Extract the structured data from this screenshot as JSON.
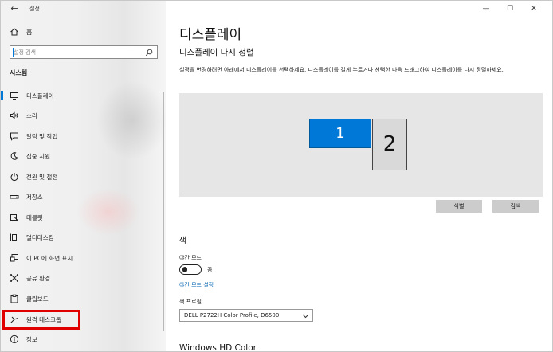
{
  "window": {
    "title": "설정",
    "controls": {
      "minimize": "—",
      "maximize": "☐",
      "close": "✕"
    }
  },
  "sidebar": {
    "home_label": "홈",
    "search": {
      "placeholder": "설정 검색",
      "value": ""
    },
    "section_title": "시스템",
    "items": [
      {
        "label": "디스플레이",
        "icon": "monitor-icon",
        "selected": true
      },
      {
        "label": "소리",
        "icon": "speaker-icon"
      },
      {
        "label": "알림 및 작업",
        "icon": "notification-icon"
      },
      {
        "label": "집중 지원",
        "icon": "moon-icon"
      },
      {
        "label": "전원 및 절전",
        "icon": "power-icon"
      },
      {
        "label": "저장소",
        "icon": "storage-icon"
      },
      {
        "label": "태블릿",
        "icon": "tablet-icon"
      },
      {
        "label": "멀티태스킹",
        "icon": "multitasking-icon"
      },
      {
        "label": "이 PC에 화면 표시",
        "icon": "project-icon"
      },
      {
        "label": "공유 환경",
        "icon": "shared-experience-icon"
      },
      {
        "label": "클립보드",
        "icon": "clipboard-icon"
      },
      {
        "label": "원격 데스크톱",
        "icon": "remote-desktop-icon",
        "highlighted": true
      },
      {
        "label": "정보",
        "icon": "info-icon"
      }
    ]
  },
  "main": {
    "page_title": "디스플레이",
    "arrange_title": "디스플레이 다시 정렬",
    "arrange_description": "설정을 변경하려면 아래에서 디스플레이를 선택하세요. 디스플레이를 길게 누르거나 선택한 다음 드래그하여 디스플레이를 다시 정렬하세요.",
    "monitors": [
      {
        "number": "1",
        "selected": true
      },
      {
        "number": "2",
        "selected": false
      }
    ],
    "identify_button": "식별",
    "detect_button": "검색",
    "color_section_title": "색",
    "night_light_label": "야간 모드",
    "night_light_state": "끔",
    "night_light_settings_link": "야간 모드 설정",
    "color_profile_label": "색 프로필",
    "color_profile_value": "DELL P2722H Color Profile, D6500",
    "hd_color_title": "Windows HD Color"
  },
  "colors": {
    "accent": "#0078d7",
    "link": "#0063b1",
    "highlight_box": "#e00000"
  }
}
